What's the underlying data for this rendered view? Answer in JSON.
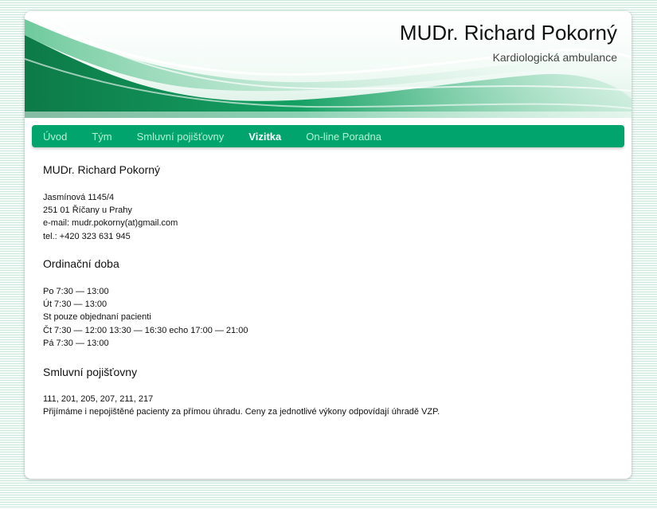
{
  "header": {
    "title": "MUDr. Richard Pokorný",
    "subtitle": "Kardiologická ambulance"
  },
  "nav": {
    "items": [
      {
        "label": "Úvod"
      },
      {
        "label": "Tým"
      },
      {
        "label": "Smluvní pojišťovny"
      },
      {
        "label": "Vizitka",
        "active": true
      },
      {
        "label": "On-line Poradna"
      }
    ]
  },
  "colors": {
    "nav_background": "#00a46c",
    "nav_text": "#b6f3d5",
    "nav_active_text": "#ffffff",
    "header_wave": "#0a8a55"
  },
  "contact": {
    "heading": "MUDr. Richard Pokorný",
    "lines": [
      "Jasmínová 1145/4",
      "251 01 Říčany u Prahy",
      "e-mail: mudr.pokorny(at)gmail.com",
      "tel.: +420 323 631 945"
    ]
  },
  "hours": {
    "heading": "Ordinační doba",
    "lines": [
      "Po 7:30 — 13:00",
      "Út 7:30 — 13:00",
      "St pouze objednaní pacienti",
      "Čt 7:30 — 12:00 13:30 — 16:30 echo 17:00 — 21:00",
      "Pá 7:30 — 13:00"
    ]
  },
  "insurance": {
    "heading": "Smluvní pojišťovny",
    "lines": [
      "111, 201, 205, 207, 211, 217",
      "Přijímáme i nepojištěné pacienty za přímou úhradu. Ceny za jednotlivé výkony odpovídají úhradě VZP."
    ]
  }
}
